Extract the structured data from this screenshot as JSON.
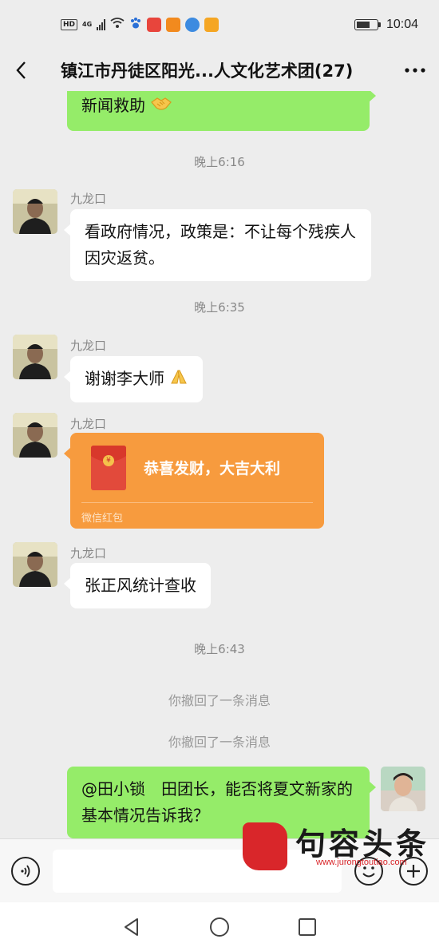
{
  "status_bar": {
    "hd": "HD",
    "network": "4G",
    "time": "10:04"
  },
  "chat": {
    "title": "镇江市丹徒区阳光...人文化艺术团(27)"
  },
  "messages": {
    "m0": {
      "type": "outgoing",
      "text": "新闻救助",
      "emoji": "handshake"
    },
    "t1": {
      "type": "time",
      "text": "晚上6:16"
    },
    "m1": {
      "type": "incoming",
      "sender": "九龙口",
      "text": "看政府情况，政策是：不让每个残疾人因灾返贫。"
    },
    "t2": {
      "type": "time",
      "text": "晚上6:35"
    },
    "m2": {
      "type": "incoming",
      "sender": "九龙口",
      "text": "谢谢李大师",
      "emoji": "praying-hands"
    },
    "m3": {
      "type": "redpacket",
      "sender": "九龙口",
      "title": "恭喜发财，大吉大利",
      "footer": "微信红包",
      "symbol": "¥"
    },
    "m4": {
      "type": "incoming",
      "sender": "九龙口",
      "text": "张正风统计查收"
    },
    "t3": {
      "type": "time",
      "text": "晚上6:43"
    },
    "r1": {
      "type": "recall",
      "text": "你撤回了一条消息"
    },
    "r2": {
      "type": "recall",
      "text": "你撤回了一条消息"
    },
    "m5": {
      "type": "outgoing",
      "text": "@田小锁　田团长，能否将夏文新家的基本情况告诉我？"
    }
  },
  "input": {
    "value": "",
    "placeholder": ""
  },
  "watermark": {
    "seal": "句容头条",
    "brand": "句容头条",
    "url": "www.jurongtoutiao.com"
  },
  "colors": {
    "background": "#ededed",
    "outgoing_bubble": "#95ec69",
    "incoming_bubble": "#ffffff",
    "redpacket": "#f79b3e"
  }
}
